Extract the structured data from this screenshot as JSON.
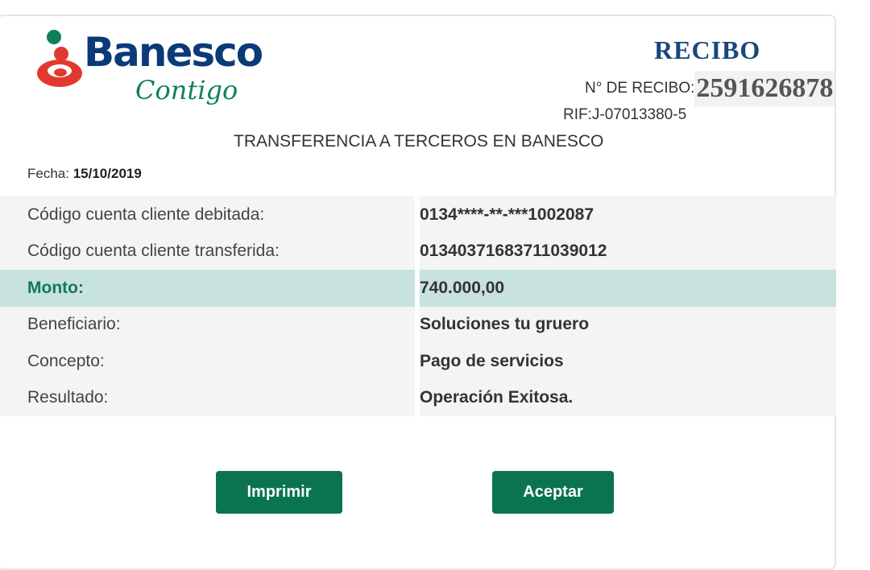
{
  "brand": {
    "name": "Banesco",
    "tagline": "Contigo",
    "colors": {
      "navy": "#0b3a78",
      "green": "#11805a",
      "red": "#e03a2f"
    }
  },
  "receipt": {
    "title": "RECIBO",
    "number_label": "N° DE RECIBO:",
    "number": "2591626878",
    "rif": "RIF:J-07013380-5"
  },
  "transaction_title": "TRANSFERENCIA A TERCEROS EN BANESCO",
  "date": {
    "label": "Fecha:",
    "value": "15/10/2019"
  },
  "details": [
    {
      "label": "Código cuenta cliente debitada:",
      "value": "0134****-**-***1002087"
    },
    {
      "label": "Código cuenta cliente transferida:",
      "value": "01340371683711039012"
    },
    {
      "label": "Monto:",
      "value": "740.000,00"
    },
    {
      "label": "Beneficiario:",
      "value": "Soluciones tu gruero"
    },
    {
      "label": "Concepto:",
      "value": "Pago de servicios"
    },
    {
      "label": "Resultado:",
      "value": "Operación Exitosa."
    }
  ],
  "buttons": {
    "print": "Imprimir",
    "accept": "Aceptar"
  },
  "accent_color": "#0a7350",
  "highlight_color": "#c8e2dd"
}
